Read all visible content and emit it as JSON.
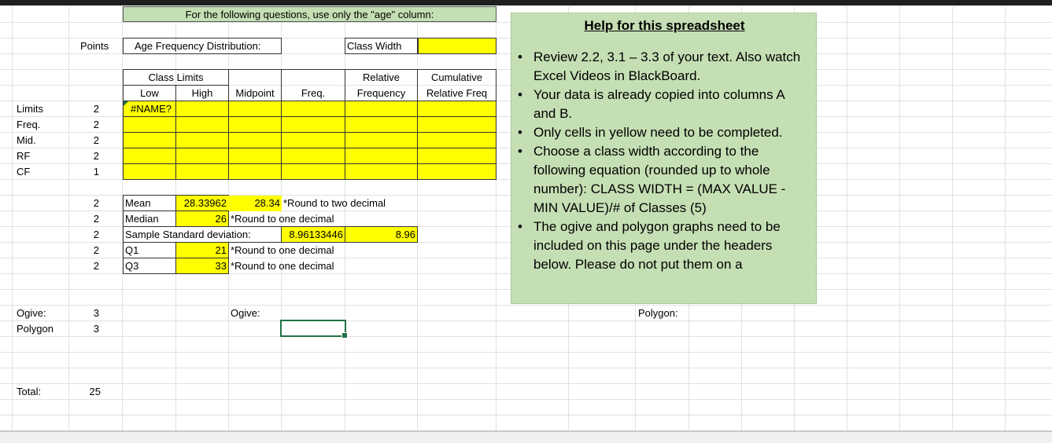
{
  "banner": "For the following questions, use only the \"age\" column:",
  "points_header": "Points",
  "freq_dist_label": "Age Frequency Distribution:",
  "class_width_label": "Class Width",
  "table_headers": {
    "class_limits": "Class Limits",
    "low": "Low",
    "high": "High",
    "midpoint": "Midpoint",
    "freq": "Freq.",
    "relative_1": "Relative",
    "relative_2": "Frequency",
    "cumulative_1": "Cumulative",
    "cumulative_2": "Relative Freq"
  },
  "error_value": "#NAME?",
  "left_rows": [
    {
      "label": "Limits",
      "points": "2"
    },
    {
      "label": "Freq.",
      "points": "2"
    },
    {
      "label": "Mid.",
      "points": "2"
    },
    {
      "label": "RF",
      "points": "2"
    },
    {
      "label": "CF",
      "points": "1"
    }
  ],
  "stats_points": [
    "2",
    "2",
    "2",
    "2",
    "2"
  ],
  "stats": {
    "mean_label": "Mean",
    "mean_value": "28.33962",
    "mean_rounded": "28.34",
    "mean_note": "*Round to two decimal",
    "median_label": "Median",
    "median_value": "26",
    "median_note": "*Round to one decimal",
    "sd_label": "Sample Standard deviation:",
    "sd_value": "8.96133446",
    "sd_rounded": "8.96",
    "q1_label": "Q1",
    "q1_value": "21",
    "q1_note": "*Round to one decimal",
    "q3_label": "Q3",
    "q3_value": "33",
    "q3_note": "*Round to one decimal"
  },
  "graph_rows": [
    {
      "label": "Ogive:",
      "points": "3"
    },
    {
      "label": "Polygon",
      "points": "3"
    }
  ],
  "ogive_header": "Ogive:",
  "polygon_header": "Polygon:",
  "total_label": "Total:",
  "total_points": "25",
  "help": {
    "title": "Help for this spreadsheet",
    "items": [
      "Review 2.2, 3.1 – 3.3 of your text. Also watch Excel Videos in BlackBoard.",
      "Your data is already copied into columns A and B.",
      "Only cells in yellow need to be completed.",
      "Choose a class width according to the following equation (rounded up to whole number): CLASS WIDTH = (MAX VALUE - MIN VALUE)/# of Classes (5)",
      "The ogive and polygon graphs need to be included on this page under the headers below. Please do not put them on a"
    ]
  },
  "colors": {
    "yellow": "#ffff00",
    "help_green": "#c5dfb4",
    "banner_green": "#c5dfb4",
    "selection_green": "#217346"
  }
}
